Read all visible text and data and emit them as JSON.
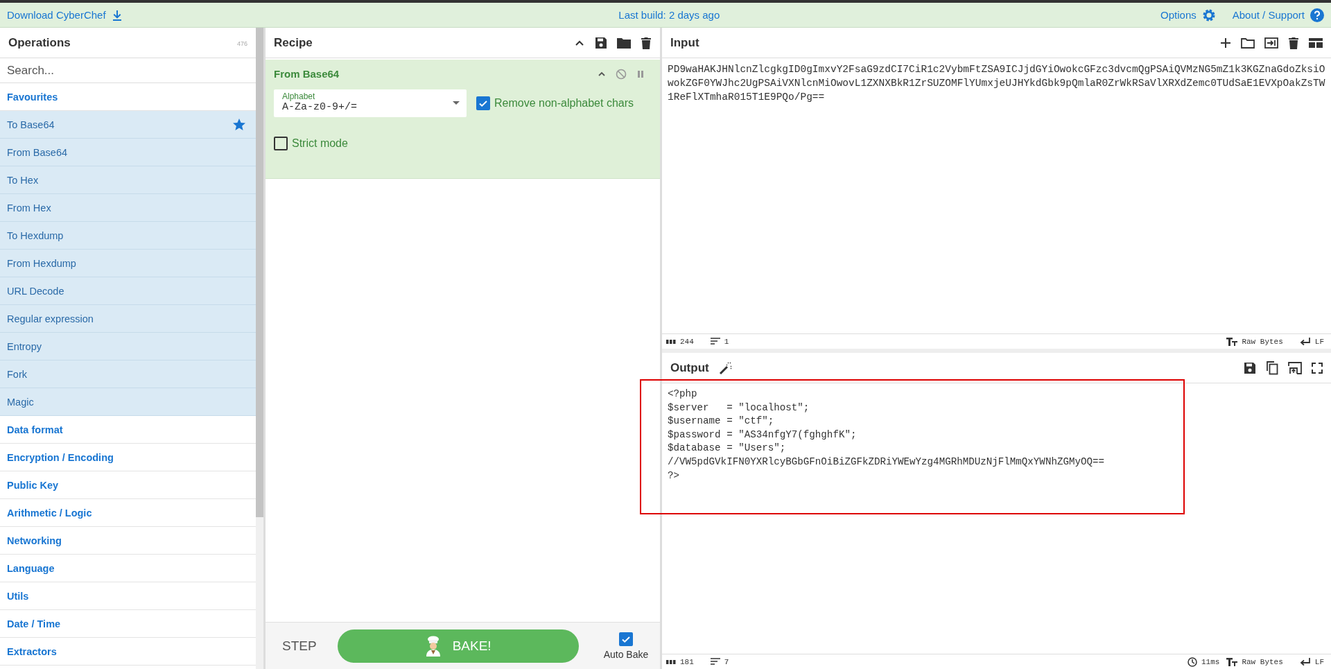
{
  "top_bar": {
    "download": "Download CyberChef",
    "build": "Last build: 2 days ago",
    "options": "Options",
    "about": "About / Support"
  },
  "operations": {
    "title": "Operations",
    "count": "476",
    "search_placeholder": "Search...",
    "favourites": {
      "label": "Favourites",
      "items": [
        "To Base64",
        "From Base64",
        "To Hex",
        "From Hex",
        "To Hexdump",
        "From Hexdump",
        "URL Decode",
        "Regular expression",
        "Entropy",
        "Fork",
        "Magic"
      ]
    },
    "categories": [
      "Data format",
      "Encryption / Encoding",
      "Public Key",
      "Arithmetic / Logic",
      "Networking",
      "Language",
      "Utils",
      "Date / Time",
      "Extractors"
    ]
  },
  "recipe": {
    "title": "Recipe",
    "operations": [
      {
        "name": "From Base64",
        "alphabet_label": "Alphabet",
        "alphabet": "A-Za-z0-9+/=",
        "options": [
          {
            "label": "Remove non-alphabet chars",
            "checked": true
          },
          {
            "label": "Strict mode",
            "checked": false
          }
        ]
      }
    ],
    "step": "STEP",
    "bake": "BAKE!",
    "auto_bake": {
      "label": "Auto Bake",
      "checked": true
    }
  },
  "input": {
    "title": "Input",
    "text": "PD9waHAKJHNlcnZlcgkgID0gImxvY2FsaG9zdCI7CiR1c2VybmFtZSA9ICJjdGYiOwokcGFzc3dvcmQgPSAiQVMzNG5mZ1k3KGZnaGdoZksiOwokZGF0YWJhc2UgPSAiVXNlcnMiOwovL1ZXNXBkR1ZrSUZOMFlYUmxjeUJHYkdGbk9pQmlaR0ZrWkRSaVlXRXdZemc0TUdSaE1EVXpOakZsTW1ReFlXTmhaR015T1E9PQo/Pg==",
    "status": {
      "chars": "244",
      "lines": "1",
      "encoding": "Raw Bytes",
      "eol": "LF"
    }
  },
  "output": {
    "title": "Output",
    "lines": [
      "<?php",
      "$server   = \"localhost\";",
      "$username = \"ctf\";",
      "$password = \"AS34nfgY7(fghghfK\";",
      "$database = \"Users\";",
      "//VW5pdGVkIFN0YXRlcyBGbGFnOiBiZGFkZDRiYWEwYzg4MGRhMDUzNjFlMmQxYWNhZGMyOQ==",
      "?>"
    ],
    "status": {
      "chars": "181",
      "lines": "7",
      "time": "11ms",
      "encoding": "Raw Bytes",
      "eol": "LF"
    }
  },
  "annotations": [
    {
      "kind": "rectangle"
    }
  ]
}
